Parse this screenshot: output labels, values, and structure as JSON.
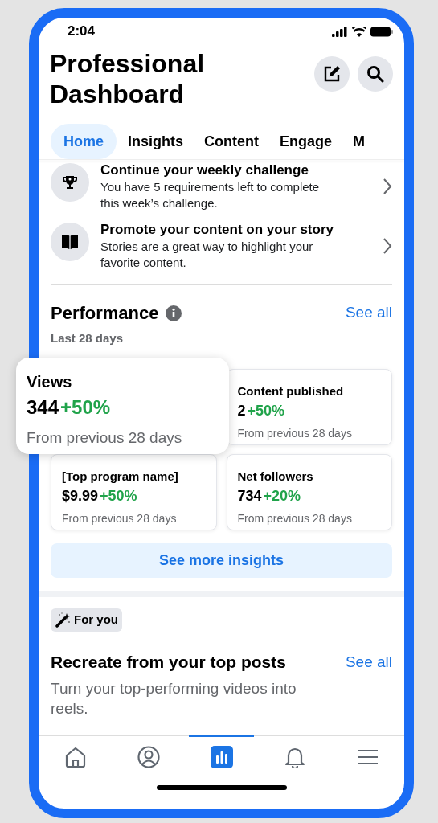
{
  "status_bar": {
    "time": "2:04"
  },
  "header": {
    "title": "Professional Dashboard"
  },
  "tabs": [
    {
      "label": "Home",
      "selected": true
    },
    {
      "label": "Insights",
      "selected": false
    },
    {
      "label": "Content",
      "selected": false
    },
    {
      "label": "Engage",
      "selected": false
    },
    {
      "label": "M",
      "selected": false
    }
  ],
  "tasks": [
    {
      "kind": "trophy",
      "title": "Continue your weekly challenge",
      "text": "You have 5 requirements left to complete this week’s challenge."
    },
    {
      "kind": "book",
      "title": "Promote your content on your story",
      "text": "Stories are a great way to highlight your favorite content."
    }
  ],
  "performance": {
    "title": "Performance",
    "see_all": "See all",
    "period": "Last 28 days",
    "metrics": [
      {
        "label": "Views",
        "value": "344",
        "change": "+50%",
        "note": "From previous 28 days",
        "highlighted": true
      },
      {
        "label": "Content published",
        "value": "2",
        "change": "+50%",
        "note": "From previous 28 days",
        "highlighted": false
      },
      {
        "label": "[Top program name]",
        "value": "$9.99",
        "change": "+50%",
        "note": "From previous 28 days",
        "highlighted": false
      },
      {
        "label": "Net followers",
        "value": "734",
        "change": "+20%",
        "note": "From previous 28 days",
        "highlighted": false
      }
    ],
    "button": "See more insights"
  },
  "for_you": {
    "chip": "For you",
    "title": "Recreate from your top posts",
    "see_all": "See all",
    "text": "Turn your top-performing videos into reels."
  },
  "bottom_nav": [
    {
      "kind": "home",
      "selected": false
    },
    {
      "kind": "profile",
      "selected": false
    },
    {
      "kind": "chart",
      "selected": true
    },
    {
      "kind": "bell",
      "selected": false
    },
    {
      "kind": "menu",
      "selected": false
    }
  ]
}
